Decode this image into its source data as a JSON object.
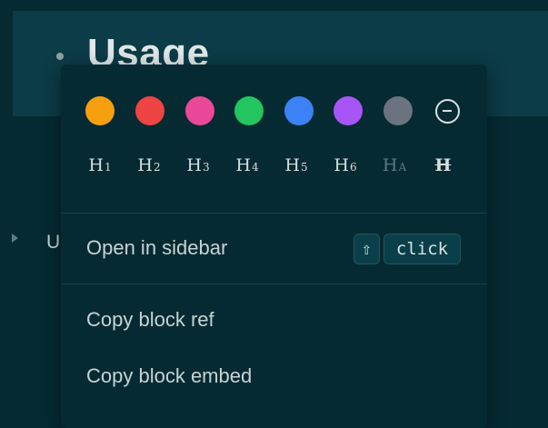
{
  "background": {
    "page_title": "Usage",
    "partial_item_letter": "U"
  },
  "menu": {
    "colors": [
      {
        "name": "yellow",
        "hex": "#f6a010"
      },
      {
        "name": "red",
        "hex": "#ef4444"
      },
      {
        "name": "pink",
        "hex": "#ec4899"
      },
      {
        "name": "green",
        "hex": "#22c55e"
      },
      {
        "name": "blue",
        "hex": "#3b82f6"
      },
      {
        "name": "purple",
        "hex": "#a855f7"
      },
      {
        "name": "gray",
        "hex": "#6b7280"
      },
      {
        "name": "clear",
        "icon": "minus-circle-icon"
      }
    ],
    "headings": [
      {
        "main": "H",
        "sub": "1"
      },
      {
        "main": "H",
        "sub": "2"
      },
      {
        "main": "H",
        "sub": "3"
      },
      {
        "main": "H",
        "sub": "4"
      },
      {
        "main": "H",
        "sub": "5"
      },
      {
        "main": "H",
        "sub": "6"
      },
      {
        "main": "H",
        "sub": "A"
      },
      {
        "main": "H",
        "sub": ""
      }
    ],
    "items": {
      "open_in_sidebar": "Open in sidebar",
      "copy_block_ref": "Copy block ref",
      "copy_block_embed": "Copy block embed"
    },
    "shortcut": {
      "shift_symbol": "⇧",
      "action": "click"
    }
  }
}
